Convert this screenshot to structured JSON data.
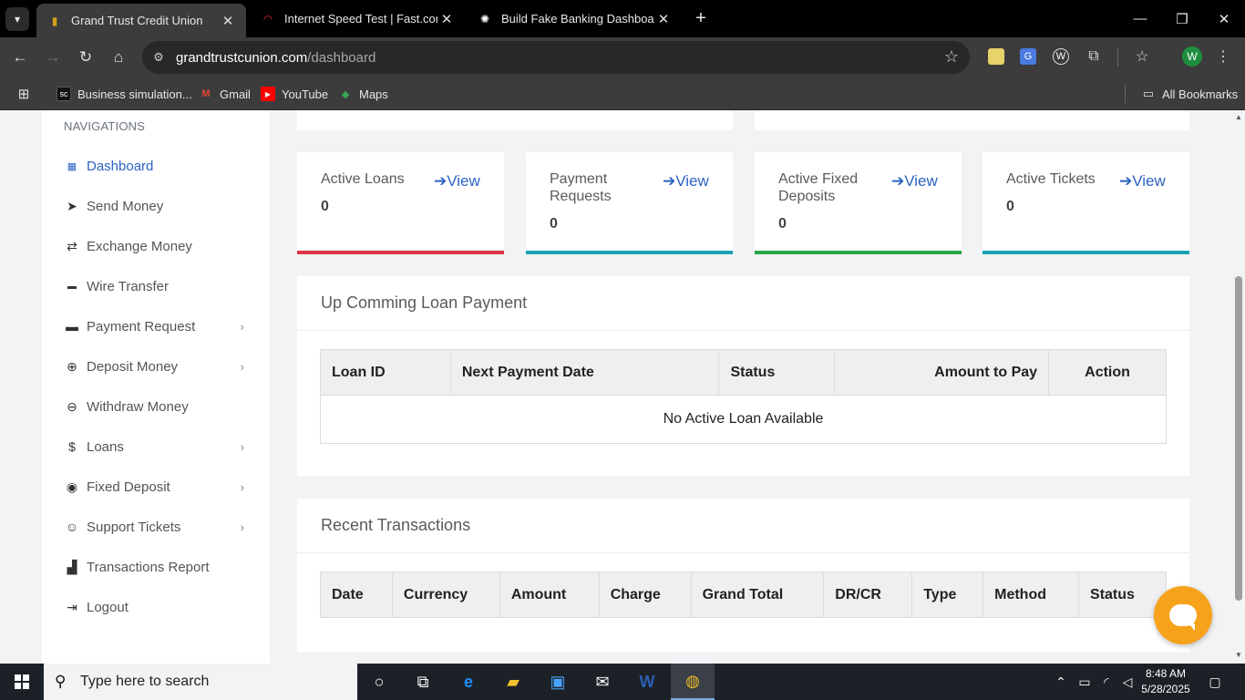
{
  "browser": {
    "tabs": [
      {
        "title": "Grand Trust Credit Union",
        "favicon": "bank-logo-icon",
        "active": true
      },
      {
        "title": "Internet Speed Test | Fast.com",
        "favicon": "speedometer-icon",
        "active": false
      },
      {
        "title": "Build Fake Banking Dashboard",
        "favicon": "openai-icon",
        "active": false
      }
    ],
    "url_domain": "grandtrustcunion.com",
    "url_path": "/dashboard",
    "profile_initial": "W",
    "bookmarks": [
      {
        "label": "Business simulation...",
        "icon": "sc-icon"
      },
      {
        "label": "Gmail",
        "icon": "gmail-icon"
      },
      {
        "label": "YouTube",
        "icon": "youtube-icon"
      },
      {
        "label": "Maps",
        "icon": "maps-icon"
      }
    ],
    "all_bookmarks": "All Bookmarks"
  },
  "sidebar": {
    "heading": "NAVIGATIONS",
    "items": [
      {
        "label": "Dashboard",
        "icon": "dashboard-icon",
        "active": true,
        "has_submenu": false
      },
      {
        "label": "Send Money",
        "icon": "send-icon",
        "has_submenu": false
      },
      {
        "label": "Exchange Money",
        "icon": "exchange-icon",
        "has_submenu": false
      },
      {
        "label": "Wire Transfer",
        "icon": "wire-transfer-icon",
        "has_submenu": false
      },
      {
        "label": "Payment Request",
        "icon": "credit-card-icon",
        "has_submenu": true
      },
      {
        "label": "Deposit Money",
        "icon": "plus-circle-icon",
        "has_submenu": true
      },
      {
        "label": "Withdraw Money",
        "icon": "minus-circle-icon",
        "has_submenu": false
      },
      {
        "label": "Loans",
        "icon": "dollar-icon",
        "has_submenu": true
      },
      {
        "label": "Fixed Deposit",
        "icon": "piggy-icon",
        "has_submenu": true
      },
      {
        "label": "Support Tickets",
        "icon": "support-agent-icon",
        "has_submenu": true
      },
      {
        "label": "Transactions Report",
        "icon": "chart-icon",
        "has_submenu": false
      },
      {
        "label": "Logout",
        "icon": "logout-icon",
        "has_submenu": false
      }
    ]
  },
  "stats": [
    {
      "title": "Active Loans",
      "value": "0",
      "view": "View",
      "color": "#dc3545"
    },
    {
      "title": "Payment Requests",
      "value": "0",
      "view": "View",
      "color": "#17a2b8"
    },
    {
      "title": "Active Fixed Deposits",
      "value": "0",
      "view": "View",
      "color": "#28a745"
    },
    {
      "title": "Active Tickets",
      "value": "0",
      "view": "View",
      "color": "#17a2b8"
    }
  ],
  "loan_panel": {
    "title": "Up Comming Loan Payment",
    "columns": [
      "Loan ID",
      "Next Payment Date",
      "Status",
      "Amount to Pay",
      "Action"
    ],
    "empty_message": "No Active Loan Available"
  },
  "transactions_panel": {
    "title": "Recent Transactions",
    "columns": [
      "Date",
      "Currency",
      "Amount",
      "Charge",
      "Grand Total",
      "DR/CR",
      "Type",
      "Method",
      "Status"
    ]
  },
  "taskbar": {
    "search_placeholder": "Type here to search",
    "time": "8:48 AM",
    "date": "5/28/2025"
  }
}
